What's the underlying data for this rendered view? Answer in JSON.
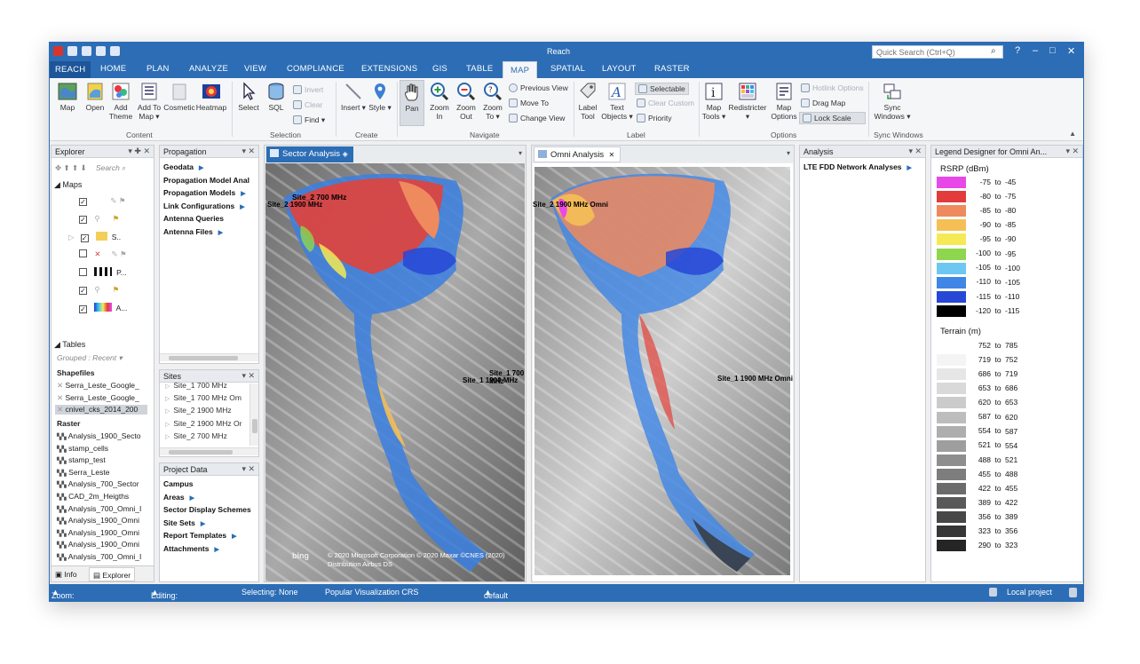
{
  "window": {
    "title": "Reach",
    "search_placeholder": "Quick Search (Ctrl+Q)",
    "help": "?",
    "min": "–",
    "max": "□",
    "close": "✕"
  },
  "tabs": [
    "REACH",
    "HOME",
    "PLAN",
    "ANALYZE",
    "VIEW",
    "COMPLIANCE",
    "EXTENSIONS",
    "GIS",
    "TABLE",
    "MAP",
    "SPATIAL",
    "LAYOUT",
    "RASTER"
  ],
  "ribbon": {
    "content": {
      "label": "Content",
      "map": "Map",
      "open": "Open",
      "add_theme_1": "Add",
      "add_theme_2": "Theme",
      "add_to_map_1": "Add To",
      "add_to_map_2": "Map ▾",
      "cosmetic": "Cosmetic",
      "heatmap": "Heatmap"
    },
    "selection": {
      "label": "Selection",
      "select": "Select",
      "sql": "SQL",
      "invert": "Invert",
      "clear": "Clear",
      "find": "Find"
    },
    "create": {
      "label": "Create",
      "insert": "Insert",
      "style": "Style"
    },
    "navigate": {
      "label": "Navigate",
      "pan": "Pan",
      "zoom_in_1": "Zoom",
      "zoom_in_2": "In",
      "zoom_out_1": "Zoom",
      "zoom_out_2": "Out",
      "zoom_to_1": "Zoom",
      "zoom_to_2": "To ▾",
      "previous_view": "Previous View",
      "move_to": "Move To",
      "change_view": "Change View"
    },
    "label": {
      "label": "Label",
      "label_tool_1": "Label",
      "label_tool_2": "Tool",
      "text_objects_1": "Text",
      "text_objects_2": "Objects ▾",
      "selectable": "Selectable",
      "clear_custom": "Clear Custom",
      "priority": "Priority"
    },
    "options": {
      "label": "Options",
      "map_tools_1": "Map",
      "map_tools_2": "Tools ▾",
      "redistricter": "Redistricter",
      "map_options_1": "Map",
      "map_options_2": "Options",
      "hotlink_options": "Hotlink Options",
      "drag_map": "Drag Map",
      "lock_scale": "Lock Scale"
    },
    "sync": {
      "label": "Sync Windows",
      "sync_windows_1": "Sync",
      "sync_windows_2": "Windows ▾"
    }
  },
  "explorer": {
    "title": "Explorer",
    "search": "Search",
    "maps_header": "Maps",
    "layers": [
      "",
      "",
      "S..",
      "",
      "P...",
      "",
      "A..."
    ],
    "tables_header": "Tables",
    "grouped": "Grouped : Recent",
    "shapefiles_header": "Shapefiles",
    "shapefiles": [
      "Serra_Leste_Google_",
      "Serra_Leste_Google_",
      "cnivel_cks_2014_200"
    ],
    "raster_header": "Raster",
    "raster": [
      "Analysis_1900_Secto",
      "stamp_cells",
      "stamp_test",
      "Serra_Leste",
      "Analysis_700_Sector",
      "CAD_2m_Heigths",
      "Analysis_700_Omni_I",
      "Analysis_1900_Omni",
      "Analysis_1900_Omni",
      "Analysis_1900_Omni",
      "Analysis_700_Omni_I"
    ],
    "tab_info": "Info",
    "tab_explorer": "Explorer"
  },
  "propagation": {
    "title": "Propagation",
    "items": [
      "Geodata",
      "Propagation Model Anal",
      "Propagation Models",
      "Link Configurations",
      "Antenna Queries",
      "Antenna Files"
    ]
  },
  "sites": {
    "title": "Sites",
    "items": [
      "Site_1 700 MHz",
      "Site_1 700 MHz Om",
      "Site_2 1900 MHz",
      "Site_2 1900 MHz Or",
      "Site_2 700 MHz"
    ]
  },
  "project_data": {
    "title": "Project Data",
    "items": [
      "Campus",
      "Areas",
      "Sector Display Schemes",
      "Site Sets",
      "Report Templates",
      "Attachments"
    ]
  },
  "sector_map": {
    "title": "Sector Analysis",
    "labels": [
      "Site_2 700 MHz",
      "Site_2 1900 MHz",
      "Site_1 700 MHz",
      "Site_1 1900 MHz"
    ],
    "copyright": "© 2020 Microsoft Corporation © 2020 Maxar ©CNES (2020) Distribution Airbus DS",
    "logo": "bing"
  },
  "omni_map": {
    "title": "Omni Analysis",
    "labels": [
      "Site_2 1900 MHz Omni",
      "Site_1 1900 MHz Omni"
    ]
  },
  "analysis": {
    "title": "Analysis",
    "items": [
      "LTE FDD Network Analyses"
    ]
  },
  "legend": {
    "title": "Legend Designer for Omni An...",
    "rsrp_title": "RSRP (dBm)",
    "rsrp": [
      {
        "lo": "-75",
        "hi": "-45",
        "color": "#e848e8"
      },
      {
        "lo": "-80",
        "hi": "-75",
        "color": "#e33b3b"
      },
      {
        "lo": "-85",
        "hi": "-80",
        "color": "#ef8a5e"
      },
      {
        "lo": "-90",
        "hi": "-85",
        "color": "#f5bf55"
      },
      {
        "lo": "-95",
        "hi": "-90",
        "color": "#f5ea55"
      },
      {
        "lo": "-100",
        "hi": "-95",
        "color": "#8ed64e"
      },
      {
        "lo": "-105",
        "hi": "-100",
        "color": "#6cc8f0"
      },
      {
        "lo": "-110",
        "hi": "-105",
        "color": "#3f86e6"
      },
      {
        "lo": "-115",
        "hi": "-110",
        "color": "#2747d6"
      },
      {
        "lo": "-120",
        "hi": "-115",
        "color": "#000000"
      }
    ],
    "terrain_title": "Terrain (m)",
    "terrain": [
      {
        "lo": "752",
        "hi": "785",
        "color": "#ffffff"
      },
      {
        "lo": "719",
        "hi": "752",
        "color": "#f4f4f4"
      },
      {
        "lo": "686",
        "hi": "719",
        "color": "#e6e6e6"
      },
      {
        "lo": "653",
        "hi": "686",
        "color": "#d9d9d9"
      },
      {
        "lo": "620",
        "hi": "653",
        "color": "#cbcbcb"
      },
      {
        "lo": "587",
        "hi": "620",
        "color": "#bdbdbd"
      },
      {
        "lo": "554",
        "hi": "587",
        "color": "#aeaeae"
      },
      {
        "lo": "521",
        "hi": "554",
        "color": "#9e9e9e"
      },
      {
        "lo": "488",
        "hi": "521",
        "color": "#8e8e8e"
      },
      {
        "lo": "455",
        "hi": "488",
        "color": "#7d7d7d"
      },
      {
        "lo": "422",
        "hi": "455",
        "color": "#6b6b6b"
      },
      {
        "lo": "389",
        "hi": "422",
        "color": "#595959"
      },
      {
        "lo": "356",
        "hi": "389",
        "color": "#474747"
      },
      {
        "lo": "323",
        "hi": "356",
        "color": "#363636"
      },
      {
        "lo": "290",
        "hi": "323",
        "color": "#252525"
      }
    ]
  },
  "status": {
    "zoom": "Zoom: 3,082 km",
    "editing": "Editing: None",
    "selecting": "Selecting: None",
    "crs": "Popular Visualization CRS",
    "layout": "default",
    "project": "Local project"
  },
  "colors": {
    "accent": "#2c6db5"
  }
}
